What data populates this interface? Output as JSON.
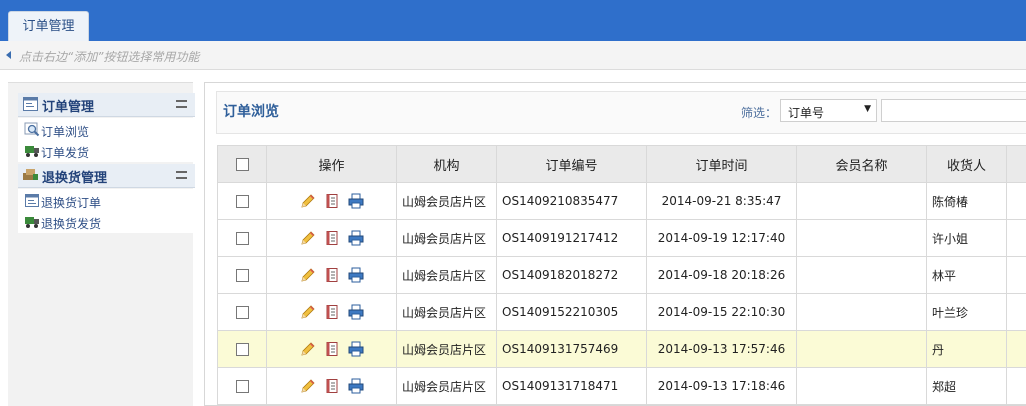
{
  "top_tab": {
    "label": "订单管理"
  },
  "hint": {
    "text": "点击右边“添加”按钮选择常用功能"
  },
  "sidebar": {
    "groups": [
      {
        "title": "订单管理",
        "icon": "order-window-icon",
        "items": [
          {
            "label": "订单浏览",
            "icon": "magnifier-icon"
          },
          {
            "label": "订单发货",
            "icon": "truck-icon"
          }
        ]
      },
      {
        "title": "退换货管理",
        "icon": "return-goods-icon",
        "items": [
          {
            "label": "退换货订单",
            "icon": "order-window-icon"
          },
          {
            "label": "退换货发货",
            "icon": "truck-icon"
          }
        ]
      }
    ]
  },
  "main": {
    "title": "订单浏览",
    "filter": {
      "label": "筛选：",
      "selected": "订单号"
    }
  },
  "table": {
    "headers": [
      "操作",
      "机构",
      "订单编号",
      "订单时间",
      "会员名称",
      "收货人"
    ],
    "row_actions": [
      "edit-pencil-icon",
      "detail-book-icon",
      "print-icon"
    ],
    "rows": [
      {
        "org": "山姆会员店片区",
        "order_no": "OS1409210835477",
        "time": "2014-09-21 8:35:47",
        "member": "",
        "receiver": "陈倚椿"
      },
      {
        "org": "山姆会员店片区",
        "order_no": "OS1409191217412",
        "time": "2014-09-19 12:17:40",
        "member": "",
        "receiver": "许小姐"
      },
      {
        "org": "山姆会员店片区",
        "order_no": "OS1409182018272",
        "time": "2014-09-18 20:18:26",
        "member": "",
        "receiver": "林平"
      },
      {
        "org": "山姆会员店片区",
        "order_no": "OS1409152210305",
        "time": "2014-09-15 22:10:30",
        "member": "",
        "receiver": "叶兰珍"
      },
      {
        "org": "山姆会员店片区",
        "order_no": "OS1409131757469",
        "time": "2014-09-13 17:57:46",
        "member": "",
        "receiver": "丹"
      },
      {
        "org": "山姆会员店片区",
        "order_no": "OS1409131718471",
        "time": "2014-09-13 17:18:46",
        "member": "",
        "receiver": "郑超"
      }
    ]
  },
  "colors": {
    "topbar": "#2f6fcb",
    "highlight_row": "#fbfbd6",
    "link": "#2f4f86"
  }
}
